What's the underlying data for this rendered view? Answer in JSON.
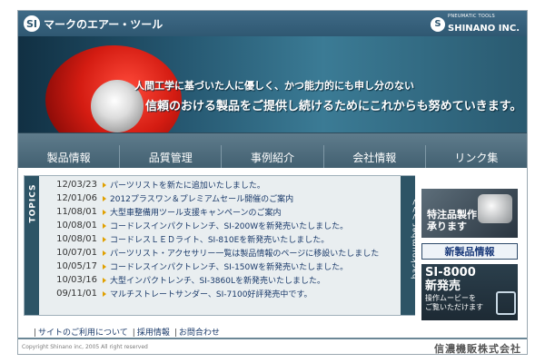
{
  "header": {
    "logo_badge": "SI",
    "logo_text": "マークのエアー・ツール",
    "brand_badge": "S",
    "brand_small": "PNEUMATIC TOOLS",
    "brand_name": "SHINANO INC."
  },
  "hero": {
    "line1": "人間工学に基づいた人に優しく、かつ能力的にも申し分のない",
    "line2": "信頼のおける製品をご提供し続けるためにこれからも努めていきます。"
  },
  "nav": [
    "製品情報",
    "品質管理",
    "事例紹介",
    "会社情報",
    "リンク集"
  ],
  "topics": {
    "label": "TOPICS",
    "backnumber": "backnumber >>>",
    "items": [
      {
        "date": "12/03/23",
        "title": "パーツリストを新たに追加いたしました。"
      },
      {
        "date": "12/01/06",
        "title": "2012プラスワン＆プレミアムセール開催のご案内"
      },
      {
        "date": "11/08/01",
        "title": "大型車整備用ツール支援キャンペーンのご案内"
      },
      {
        "date": "10/08/01",
        "title": "コードレスインパクトレンチ、SI-200Wを新発売いたしました。"
      },
      {
        "date": "10/08/01",
        "title": "コードレスＬＥＤライト、SI-810Eを新発売いたしました。"
      },
      {
        "date": "10/07/01",
        "title": "パーツリスト・アクセサリー一覧は製品情報のページに移設いたしました"
      },
      {
        "date": "10/05/17",
        "title": "コードレスインパクトレンチ、SI-150Wを新発売いたしました。"
      },
      {
        "date": "10/03/16",
        "title": "大型インパクトレンチ、SI-3860Lを新発売いたしました。"
      },
      {
        "date": "09/11/01",
        "title": "マルチストレートサンダー、SI-7100好評発売中です。"
      }
    ]
  },
  "banners": {
    "b1_line1": "特注品製作",
    "b1_line2": "承ります",
    "b2": "新製品情報",
    "b3_line1": "SI-8000",
    "b3_line2": "新発売",
    "b3_sub1": "操作ムービーを",
    "b3_sub2": "ご覧いただけます"
  },
  "footer": {
    "links": [
      "サイトのご利用について",
      "採用情報",
      "お問合わせ"
    ],
    "copyright": "Copyright Shinano inc, 2005 All right reserved",
    "company": "信濃機販株式会社"
  }
}
